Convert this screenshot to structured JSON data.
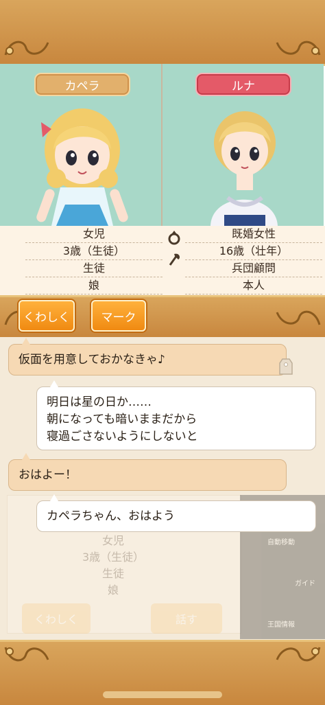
{
  "characters": {
    "left": {
      "name": "カペラ",
      "info": [
        "女児",
        "3歳（生徒）",
        "生徒",
        "娘"
      ]
    },
    "right": {
      "name": "ルナ",
      "info": [
        "既婚女性",
        "16歳（壮年）",
        "兵団顧問",
        "本人"
      ]
    }
  },
  "buttons": {
    "detail_label": "くわしく",
    "mark_label": "マーク"
  },
  "chat": {
    "messages": [
      {
        "side": "left",
        "text": "仮面を用意しておかなきゃ♪"
      },
      {
        "side": "right",
        "lines": [
          "明日は星の日か……",
          "朝になっても暗いままだから",
          "寝過ごさないようにしないと"
        ]
      },
      {
        "side": "left",
        "text": "おはよー！"
      },
      {
        "side": "right",
        "text": "カペラちゃん、おはよう"
      }
    ]
  },
  "background_ghost": {
    "info": [
      "女児",
      "3歳（生徒）",
      "生徒",
      "娘"
    ],
    "detail_label": "くわしく",
    "talk_label": "話す",
    "menu_labels": [
      "自動移動",
      "ガイド",
      "王国情報"
    ]
  },
  "colors": {
    "frame": "#c8873e",
    "panel_bg": "#a8d8c8",
    "name_left": "#e2b06c",
    "name_right": "#e45a68",
    "button": "#f08a12"
  }
}
